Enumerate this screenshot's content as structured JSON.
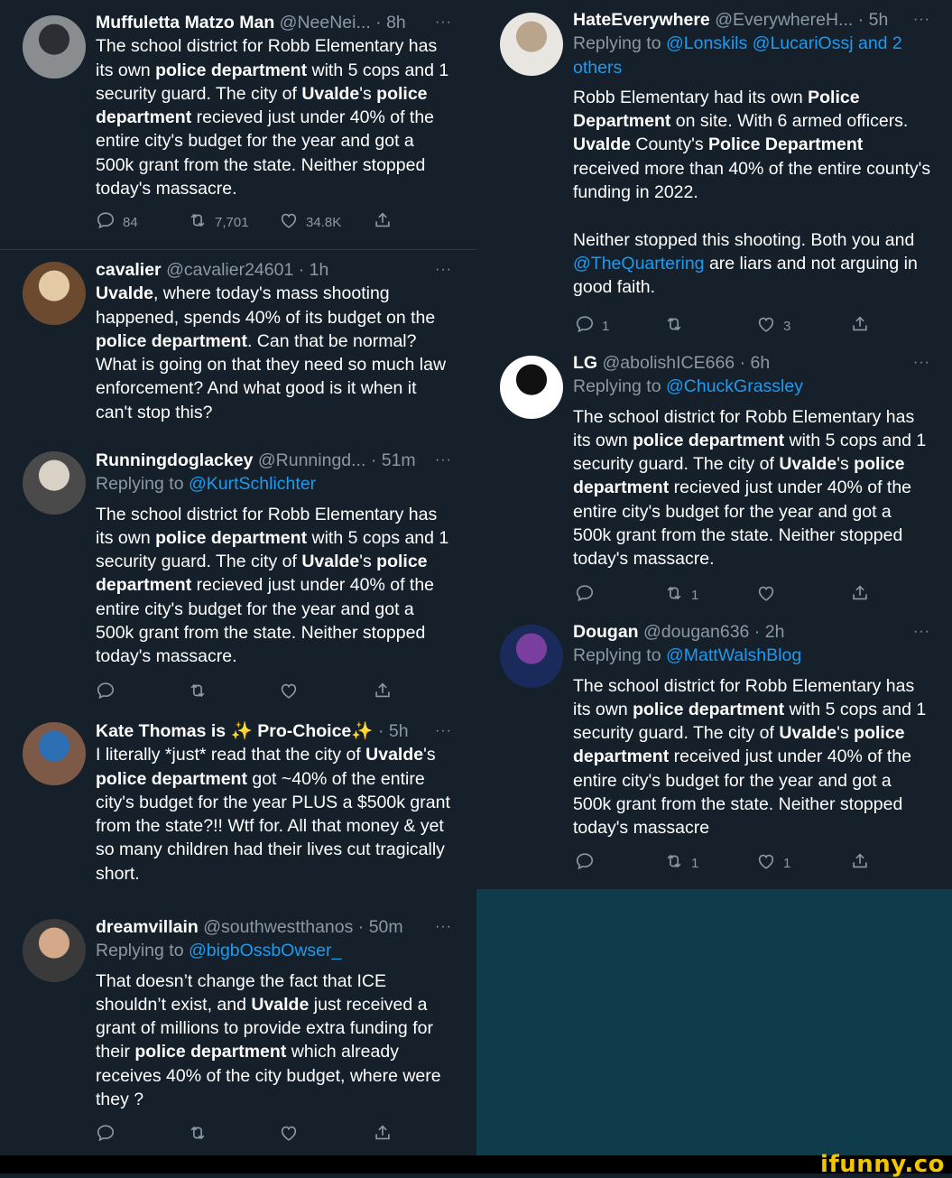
{
  "left": [
    {
      "name": "Muffuletta Matzo Man",
      "handle": "@NeeNei...",
      "time": "· 8h",
      "replying": null,
      "text": [
        "The school district for Robb Elementary has its own ",
        {
          "b": "police department"
        },
        " with 5 cops and 1 security guard. The city of ",
        {
          "b": "Uvalde"
        },
        "'s ",
        {
          "b": "police department"
        },
        " recieved just under 40% of the entire city's budget for the year and got a 500k grant from the state. Neither stopped today's massacre."
      ],
      "stats": {
        "reply": "84",
        "retweet": "7,701",
        "like": "34.8K"
      }
    },
    {
      "name": "cavalier",
      "handle": "@cavalier24601",
      "time": "· 1h",
      "replying": null,
      "text": [
        {
          "b": "Uvalde"
        },
        ", where today's mass shooting happened, spends 40% of its budget on the ",
        {
          "b": "police department"
        },
        ". Can that be normal? What is going on that they need so much law enforcement? And what good is it when it can't stop this?"
      ],
      "stats": null
    },
    {
      "name": "Runningdoglackey",
      "handle": "@Runningd...",
      "time": "· 51m",
      "replying": {
        "prefix": "Replying to ",
        "targets": "@KurtSchlichter"
      },
      "text": [
        "The school district for Robb Elementary has its own ",
        {
          "b": "police department"
        },
        " with 5 cops and 1 security guard. The city of ",
        {
          "b": "Uvalde"
        },
        "'s ",
        {
          "b": "police department"
        },
        " recieved just under 40% of the entire city's budget for the year and got a 500k grant from the state. Neither stopped today's massacre."
      ],
      "stats": {
        "reply": "",
        "retweet": "",
        "like": ""
      }
    },
    {
      "name": "Kate Thomas is ✨ Pro-Choice✨",
      "handle": "",
      "time": "· 5h",
      "replying": null,
      "text": [
        "I literally *just* read that the city of ",
        {
          "b": "Uvalde"
        },
        "'s ",
        {
          "b": "police department"
        },
        " got ~40% of the entire city's budget for the year PLUS a $500k grant from the state?!! Wtf for. All that money & yet so many children had their lives cut tragically short."
      ],
      "stats": null
    },
    {
      "name": "dreamvillain",
      "handle": "@southwestthanos",
      "time": "· 50m",
      "replying": {
        "prefix": "Replying to ",
        "targets": "@bigbOssbOwser_"
      },
      "text": [
        "That doesn’t change the fact that ICE shouldn’t exist, and ",
        {
          "b": "Uvalde"
        },
        " just received a grant of millions to provide extra funding for their ",
        {
          "b": "police department"
        },
        " which already receives 40% of the city budget, where were they ?"
      ],
      "stats": {
        "reply": "",
        "retweet": "",
        "like": ""
      }
    }
  ],
  "right": [
    {
      "name": "HateEverywhere",
      "handle": "@EverywhereH...",
      "time": "· 5h",
      "replying": {
        "prefix": "Replying to ",
        "targets": "@Lonskils @LucariOssj and 2 others"
      },
      "text": [
        "Robb Elementary had its own ",
        {
          "b": "Police Department"
        },
        " on site. With 6 armed officers. ",
        {
          "b": "Uvalde"
        },
        " County's ",
        {
          "b": "Police Department"
        },
        " received more than 40% of the entire county's funding in 2022.",
        {
          "br": true
        },
        {
          "br": true
        },
        "Neither stopped this shooting. Both you and ",
        {
          "link": "@TheQuartering"
        },
        " are liars and not arguing in good faith."
      ],
      "stats": {
        "reply": "1",
        "retweet": "",
        "like": "3"
      }
    },
    {
      "name": "LG",
      "handle": "@abolishICE666",
      "time": "· 6h",
      "replying": {
        "prefix": "Replying to ",
        "targets": "@ChuckGrassley"
      },
      "text": [
        "The school district for Robb Elementary has its own ",
        {
          "b": "police department"
        },
        " with 5 cops and 1 security guard. The city of ",
        {
          "b": "Uvalde"
        },
        "'s ",
        {
          "b": "police department"
        },
        " recieved just under 40% of the entire city's budget for the year and got a 500k grant from the state. Neither stopped today's massacre."
      ],
      "stats": {
        "reply": "",
        "retweet": "1",
        "like": ""
      }
    },
    {
      "name": "Dougan",
      "handle": "@dougan636",
      "time": "· 2h",
      "replying": {
        "prefix": "Replying to ",
        "targets": "@MattWalshBlog"
      },
      "text": [
        "The school district for Robb Elementary has its own ",
        {
          "b": "police department"
        },
        " with 5 cops and 1 security guard. The city of ",
        {
          "b": "Uvalde"
        },
        "'s ",
        {
          "b": "police department"
        },
        " received just under 40% of the entire city's budget for the year and got a 500k grant from the state. Neither stopped today's massacre"
      ],
      "stats": {
        "reply": "",
        "retweet": "1",
        "like": "1"
      }
    }
  ],
  "icons": {
    "more": "more-icon",
    "reply": "reply-icon",
    "retweet": "retweet-icon",
    "like": "like-icon",
    "share": "share-icon"
  },
  "watermark": "ifunny.co",
  "colors": {
    "background": "#15202b",
    "link": "#1d9bf0",
    "muted": "#8b98a5",
    "panel": "#0f3c4a",
    "watermark": "#f2c500"
  }
}
